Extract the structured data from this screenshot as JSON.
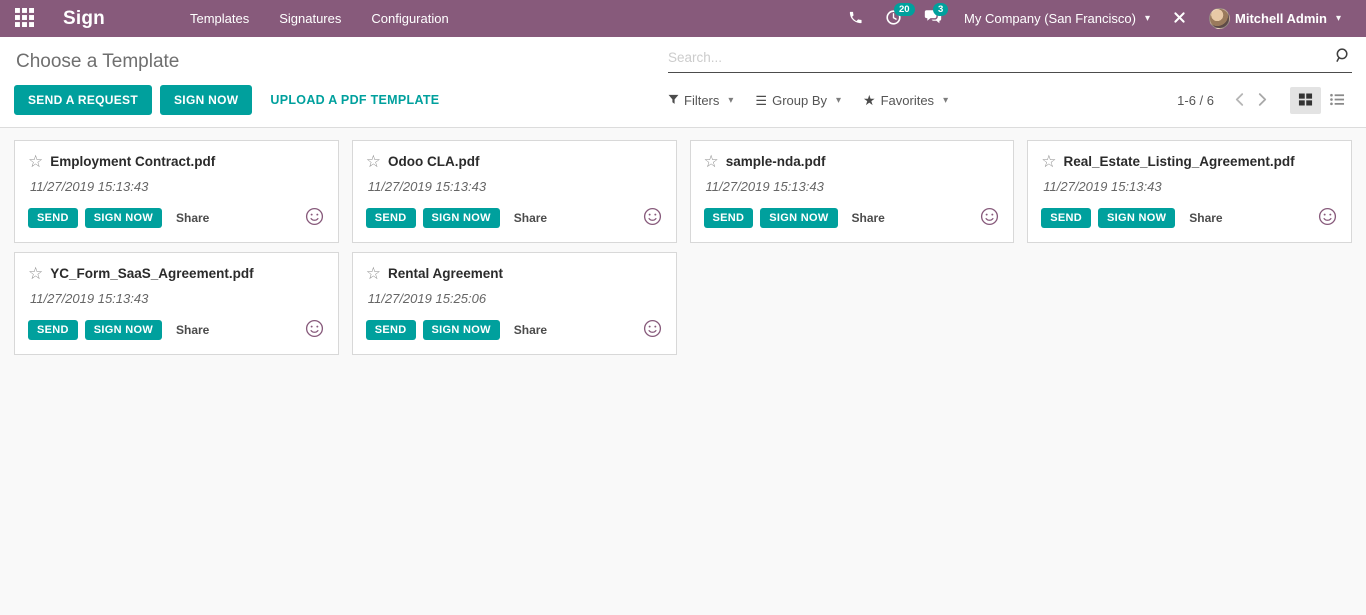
{
  "navbar": {
    "app_name": "Sign",
    "menu_items": [
      {
        "label": "Templates"
      },
      {
        "label": "Signatures"
      },
      {
        "label": "Configuration"
      }
    ],
    "activity_count": "20",
    "message_count": "3",
    "company": "My Company (San Francisco)",
    "user": "Mitchell Admin"
  },
  "control_panel": {
    "title": "Choose a Template",
    "send_request_label": "SEND A REQUEST",
    "sign_now_label": "SIGN NOW",
    "upload_label": "UPLOAD A PDF TEMPLATE",
    "search_placeholder": "Search...",
    "filters_label": "Filters",
    "group_by_label": "Group By",
    "favorites_label": "Favorites",
    "pager": "1-6 / 6"
  },
  "card_actions": {
    "send": "SEND",
    "sign_now": "SIGN NOW",
    "share": "Share"
  },
  "cards": [
    {
      "name": "Employment Contract.pdf",
      "date": "11/27/2019 15:13:43"
    },
    {
      "name": "Odoo CLA.pdf",
      "date": "11/27/2019 15:13:43"
    },
    {
      "name": "sample-nda.pdf",
      "date": "11/27/2019 15:13:43"
    },
    {
      "name": "Real_Estate_Listing_Agreement.pdf",
      "date": "11/27/2019 15:13:43"
    },
    {
      "name": "YC_Form_SaaS_Agreement.pdf",
      "date": "11/27/2019 15:13:43"
    },
    {
      "name": "Rental Agreement",
      "date": "11/27/2019 15:25:06"
    }
  ],
  "icons": {
    "caret": "▾",
    "group_by_glyph": "☰",
    "favorites_glyph": "★",
    "card_star_glyph": "☆"
  },
  "colors": {
    "navbar": "#875A7B",
    "accent": "#00A09D",
    "content_bg": "#f9f9f9",
    "card_border": "#d8d8d8"
  }
}
